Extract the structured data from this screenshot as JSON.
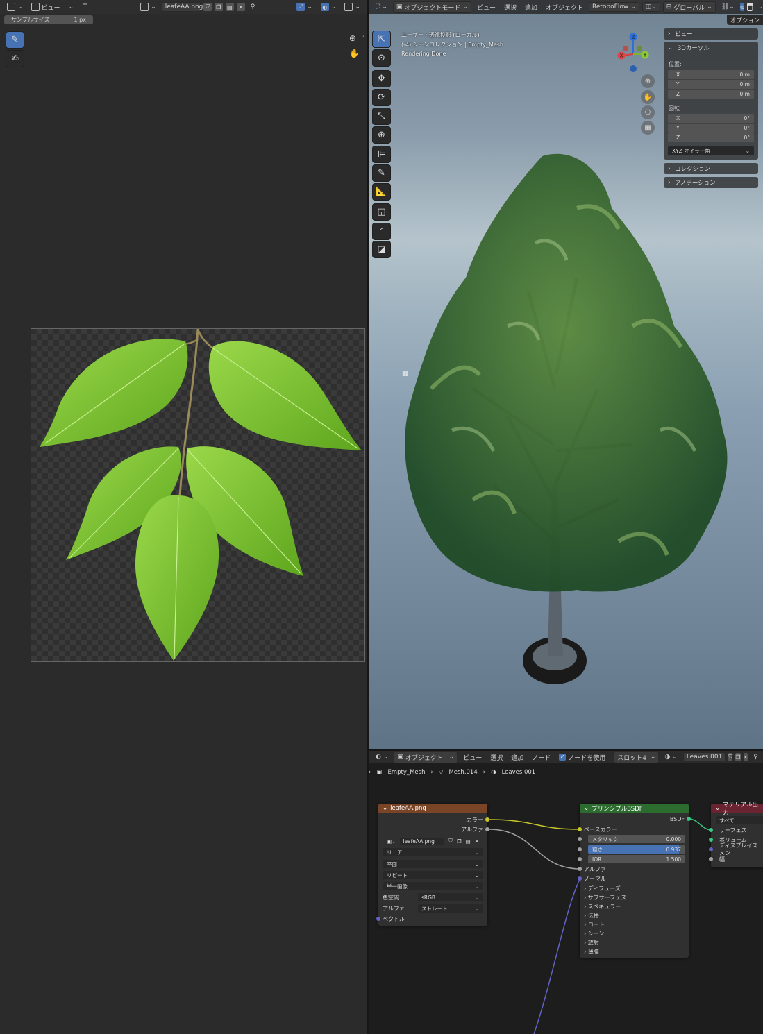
{
  "image_editor": {
    "header": {
      "menu_view": "ビュー",
      "image_name": "leafeAA.png"
    },
    "tool_settings": {
      "sample_size_label": "サンプルサイズ",
      "sample_size_value": "1 px"
    }
  },
  "viewport": {
    "header": {
      "mode": "オブジェクトモード",
      "menus": [
        "ビュー",
        "選択",
        "追加",
        "オブジェクト"
      ],
      "addon": "RetopoFlow",
      "transform_orientation": "グローバル",
      "options": "オプション"
    },
    "overlay_text": {
      "line1": "ユーザー・透視投影 (ローカル)",
      "line2": "(-4) シーンコレクション | Empty_Mesh",
      "line3": "Rendering Done"
    },
    "n_panel": {
      "view_label": "ビュー",
      "cursor_label": "3Dカーソル",
      "location_label": "位置:",
      "location": [
        {
          "axis": "X",
          "value": "0 m"
        },
        {
          "axis": "Y",
          "value": "0 m"
        },
        {
          "axis": "Z",
          "value": "0 m"
        }
      ],
      "rotation_label": "回転:",
      "rotation": [
        {
          "axis": "X",
          "value": "0°"
        },
        {
          "axis": "Y",
          "value": "0°"
        },
        {
          "axis": "Z",
          "value": "0°"
        }
      ],
      "rotation_mode": "XYZ オイラー角",
      "collection_label": "コレクション",
      "annotation_label": "アノテーション"
    },
    "gizmo": {
      "x": "X",
      "y": "Y",
      "z": "Z"
    }
  },
  "node_editor": {
    "header": {
      "object_type": "オブジェクト",
      "menus": [
        "ビュー",
        "選択",
        "追加",
        "ノード"
      ],
      "use_nodes_label": "ノードを使用",
      "slot": "スロット4",
      "material_name": "Leaves.001"
    },
    "breadcrumb": {
      "object": "Empty_Mesh",
      "mesh": "Mesh.014",
      "material": "Leaves.001"
    },
    "image_node": {
      "title": "leafeAA.png",
      "out_color": "カラー",
      "out_alpha": "アルファ",
      "image_name": "leafeAA.png",
      "interpolation": "リニア",
      "projection": "平面",
      "extension": "リピート",
      "source": "単一画像",
      "colorspace_label": "色空間",
      "colorspace_value": "sRGB",
      "alpha_label": "アルファ",
      "alpha_value": "ストレート",
      "in_vector": "ベクトル"
    },
    "bsdf_node": {
      "title": "プリンシプルBSDF",
      "out_bsdf": "BSDF",
      "base_color": "ベースカラー",
      "metallic_label": "メタリック",
      "metallic_value": "0.000",
      "roughness_label": "粗さ",
      "roughness_value": "0.937",
      "roughness_fraction": 0.937,
      "ior_label": "IOR",
      "ior_value": "1.500",
      "alpha": "アルファ",
      "normal": "ノーマル",
      "sections": [
        "ディフューズ",
        "サブサーフェス",
        "スペキュラー",
        "伝播",
        "コート",
        "シーン",
        "放射",
        "薄膜"
      ]
    },
    "output_node": {
      "title": "マテリアル出力",
      "target": "すべて",
      "in_surface": "サーフェス",
      "in_volume": "ボリューム",
      "in_displacement": "ディスプレイスメン",
      "in_thickness": "幅"
    }
  },
  "colors": {
    "accent": "#4772b3",
    "image_node_header": "#7a4526",
    "shader_node_header": "#2c6c2e",
    "output_node_header": "#6a2330",
    "link_yellow": "#c7c729",
    "link_grey": "#a1a1a1",
    "link_purple": "#6363c7"
  }
}
